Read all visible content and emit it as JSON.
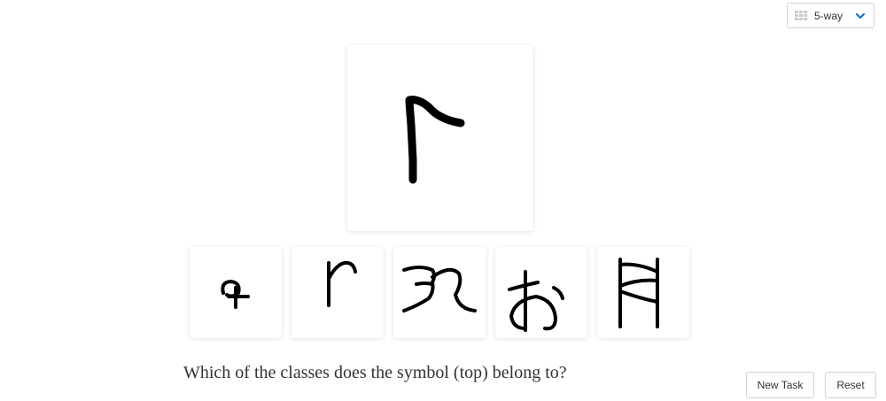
{
  "way_select": {
    "selected": "5-way",
    "icon": "grid-icon"
  },
  "task": {
    "question": "Which of the classes does the symbol (top) belong to?",
    "query_symbol": "handwritten-character",
    "option_count": 5
  },
  "buttons": {
    "new_task": "New Task",
    "reset": "Reset"
  },
  "colors": {
    "border": "#cfd3d7",
    "accent": "#1a73c6",
    "ink": "#000000"
  }
}
